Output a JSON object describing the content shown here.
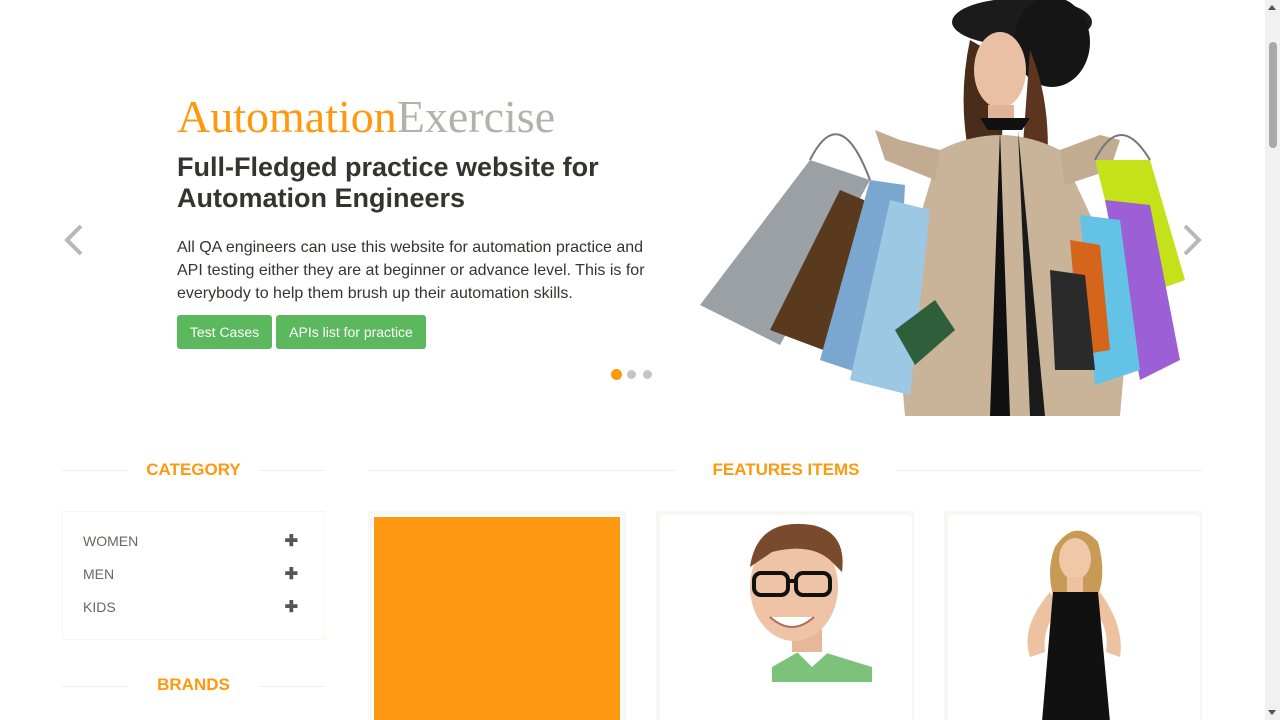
{
  "slider": {
    "brand_part1": "Automation",
    "brand_part2": "Exercise",
    "headline": "Full-Fledged practice website for Automation Engineers",
    "description": "All QA engineers can use this website for automation practice and API testing either they are at beginner or advance level. This is for everybody to help them brush up their automation skills.",
    "buttons": [
      {
        "label": "Test Cases"
      },
      {
        "label": "APIs list for practice"
      }
    ],
    "active_slide": 1,
    "slide_count": 3,
    "prev_icon": "chevron-left-icon",
    "next_icon": "chevron-right-icon"
  },
  "category": {
    "title": "CATEGORY",
    "items": [
      {
        "label": "WOMEN"
      },
      {
        "label": "MEN"
      },
      {
        "label": "KIDS"
      }
    ],
    "expand_icon": "plus-icon"
  },
  "brands": {
    "title": "BRANDS"
  },
  "features": {
    "title": "FEATURES ITEMS"
  },
  "colors": {
    "accent": "#fe980f",
    "button": "#5cb85c",
    "brand_secondary": "#b4b1ab"
  }
}
